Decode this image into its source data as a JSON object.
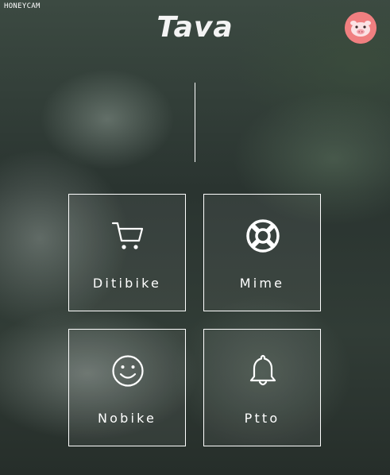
{
  "watermark": "HONEYCAM",
  "app": {
    "title": "Tava"
  },
  "avatar": {
    "icon": "pig-face-icon",
    "color": "#f07f80"
  },
  "tiles": [
    {
      "label": "Ditibike",
      "icon": "shopping-cart-icon"
    },
    {
      "label": "Mime",
      "icon": "life-ring-icon"
    },
    {
      "label": "Nobike",
      "icon": "smiley-face-icon"
    },
    {
      "label": "Ptto",
      "icon": "bell-icon"
    }
  ]
}
